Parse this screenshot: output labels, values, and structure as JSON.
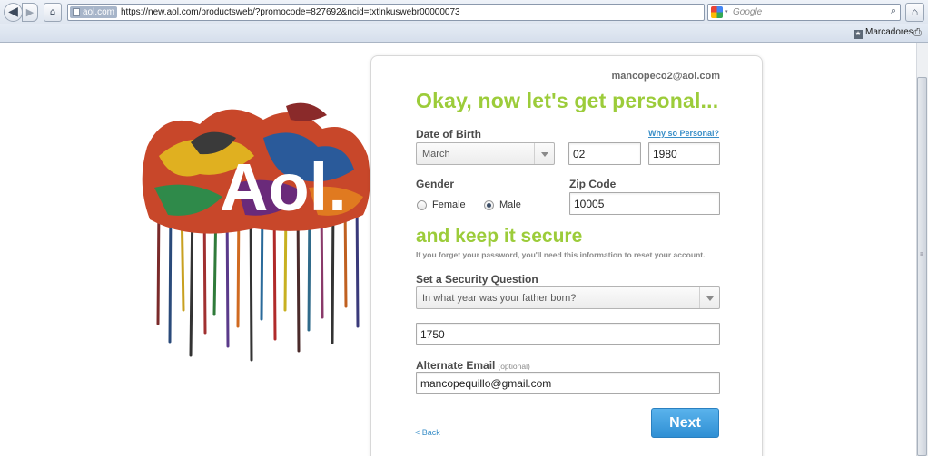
{
  "browser": {
    "nav": {
      "back_icon": "back-arrow-icon",
      "forward_icon": "forward-arrow-icon",
      "back_glyph": "◀",
      "forward_glyph": "▶",
      "identity_glyph": "⌂"
    },
    "url": {
      "site_badge": "aol.com",
      "address": "https://new.aol.com/productsweb/?promocode=827692&ncid=txtlnkuswebr00000073"
    },
    "bookmark_star_glyph": "☆",
    "reload_glyph": "C",
    "search": {
      "placeholder": "Google",
      "go_glyph": "⌕"
    },
    "home_glyph": "⌂",
    "bookmarks_bar": {
      "label": "Marcadores",
      "print_glyph": "⎙"
    }
  },
  "page": {
    "logo_text": "Aol.",
    "account_email": "mancopeco2@aol.com",
    "heading": "Okay, now let's get personal...",
    "dob": {
      "label": "Date of Birth",
      "why_link": "Why so Personal?",
      "month": "March",
      "day": "02",
      "year": "1980"
    },
    "gender": {
      "label": "Gender",
      "options": [
        "Female",
        "Male"
      ],
      "selected": "Male"
    },
    "zip": {
      "label": "Zip Code",
      "value": "10005"
    },
    "secure": {
      "heading": "and keep it secure",
      "note": "If you forget your password, you'll need this information to reset your account."
    },
    "security_question": {
      "label": "Set a Security Question",
      "selected": "In what year was your father born?",
      "answer": "1750"
    },
    "alternate_email": {
      "label": "Alternate Email",
      "optional": "(optional)",
      "value": "mancopequillo@gmail.com"
    },
    "back_link": "< Back",
    "next_button": "Next"
  },
  "colors": {
    "heading_green": "#9ccc3a",
    "link_blue": "#3a8fc8",
    "next_button": "#3d9fe0"
  }
}
